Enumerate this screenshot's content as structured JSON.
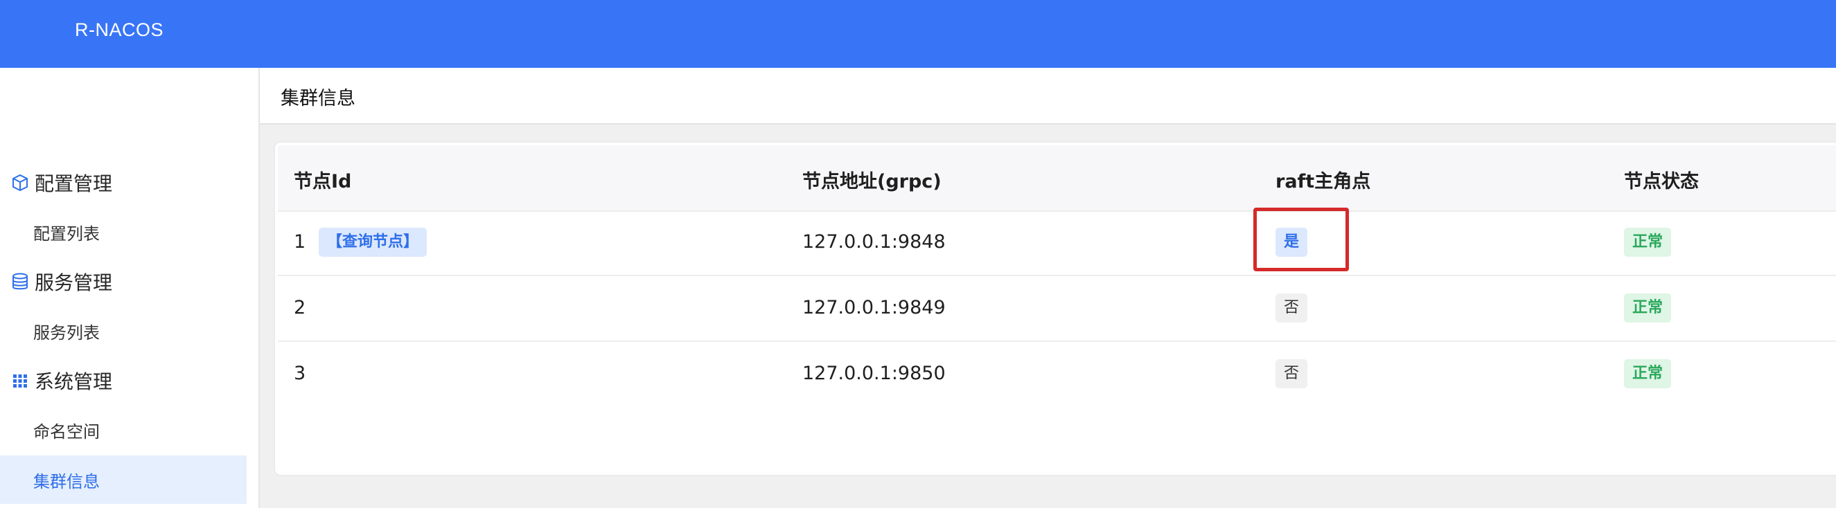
{
  "app": {
    "brand": "R-NACOS"
  },
  "sidebar": {
    "groups": [
      {
        "label": "配置管理",
        "icon": "cube-icon"
      },
      {
        "label": "服务管理",
        "icon": "database-icon"
      },
      {
        "label": "系统管理",
        "icon": "grid-icon"
      }
    ],
    "items": [
      {
        "label": "配置列表"
      },
      {
        "label": "服务列表"
      },
      {
        "label": "命名空间"
      },
      {
        "label": "集群信息"
      }
    ],
    "active_item": "集群信息"
  },
  "page": {
    "title": "集群信息"
  },
  "table": {
    "columns": [
      "节点Id",
      "节点地址(grpc)",
      "raft主角点",
      "节点状态"
    ],
    "rows": [
      {
        "id": "1",
        "query_tag": "【查询节点】",
        "address": "127.0.0.1:9848",
        "raft_leader": "是",
        "status": "正常"
      },
      {
        "id": "2",
        "address": "127.0.0.1:9849",
        "raft_leader": "否",
        "status": "正常"
      },
      {
        "id": "3",
        "address": "127.0.0.1:9850",
        "raft_leader": "否",
        "status": "正常"
      }
    ]
  },
  "colors": {
    "header_bg": "#3875f6",
    "active_bg": "#e6effd",
    "accent": "#2f6fea",
    "status_green": "#2aa85b",
    "highlight_red": "#d42a2a"
  }
}
